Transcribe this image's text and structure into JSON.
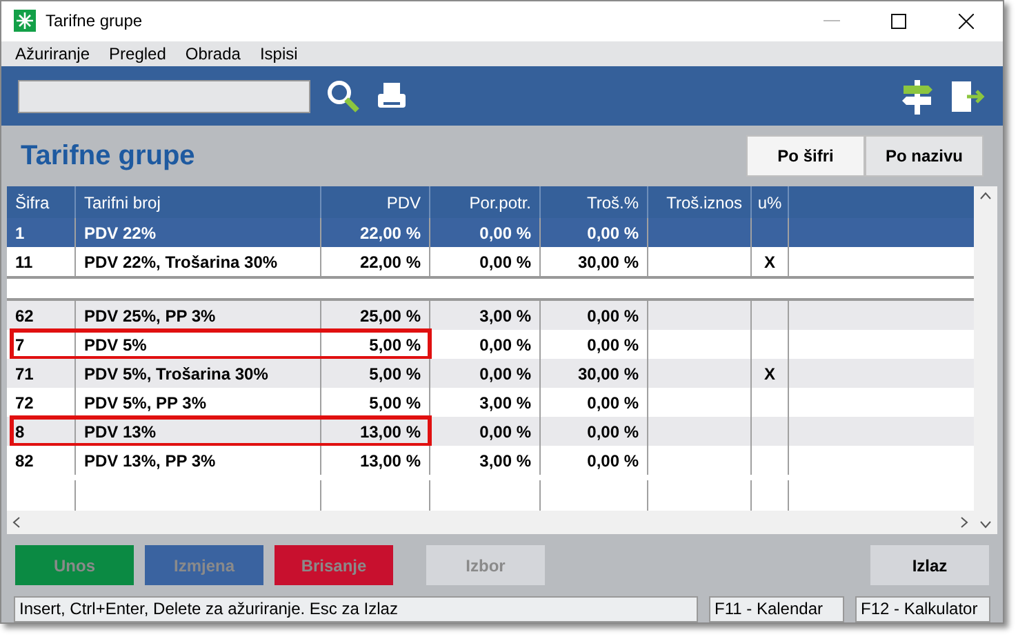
{
  "window": {
    "title": "Tarifne grupe"
  },
  "menu": [
    "Ažuriranje",
    "Pregled",
    "Obrada",
    "Ispisi"
  ],
  "heading": "Tarifne grupe",
  "sort_tabs": [
    {
      "label": "Po šifri",
      "selected": true
    },
    {
      "label": "Po nazivu",
      "selected": false
    }
  ],
  "table": {
    "columns": [
      "Šifra",
      "Tarifni broj",
      "PDV",
      "Por.potr.",
      "Troš.%",
      "Troš.iznos",
      "u%"
    ],
    "segments": [
      {
        "rows": [
          {
            "cells": [
              "1",
              "PDV 22%",
              "22,00 %",
              "0,00 %",
              "0,00 %",
              "",
              ""
            ],
            "selected": true,
            "marked": false
          },
          {
            "cells": [
              "11",
              "PDV 22%, Trošarina 30%",
              "22,00 %",
              "0,00 %",
              "30,00 %",
              "",
              "X"
            ],
            "selected": false,
            "marked": false
          }
        ]
      },
      {
        "rows": [
          {
            "cells": [
              "62",
              "PDV 25%, PP 3%",
              "25,00 %",
              "3,00 %",
              "0,00 %",
              "",
              ""
            ],
            "selected": false,
            "marked": false
          },
          {
            "cells": [
              "7",
              "PDV 5%",
              "5,00 %",
              "0,00 %",
              "0,00 %",
              "",
              ""
            ],
            "selected": false,
            "marked": true
          },
          {
            "cells": [
              "71",
              "PDV 5%, Trošarina 30%",
              "5,00 %",
              "0,00 %",
              "30,00 %",
              "",
              "X"
            ],
            "selected": false,
            "marked": false
          },
          {
            "cells": [
              "72",
              "PDV 5%, PP 3%",
              "5,00 %",
              "3,00 %",
              "0,00 %",
              "",
              ""
            ],
            "selected": false,
            "marked": false
          },
          {
            "cells": [
              "8",
              "PDV 13%",
              "13,00 %",
              "0,00 %",
              "0,00 %",
              "",
              ""
            ],
            "selected": false,
            "marked": true
          },
          {
            "cells": [
              "82",
              "PDV 13%, PP 3%",
              "13,00 %",
              "3,00 %",
              "0,00 %",
              "",
              ""
            ],
            "selected": false,
            "marked": false
          }
        ]
      }
    ]
  },
  "buttons": [
    {
      "label": "Unos",
      "kind": "green",
      "disabled": true
    },
    {
      "label": "Izmjena",
      "kind": "blue",
      "disabled": true
    },
    {
      "label": "Brisanje",
      "kind": "red",
      "disabled": true
    },
    {
      "label": "Izbor",
      "kind": "gray",
      "disabled": true
    },
    {
      "label": "Izlaz",
      "kind": "gray",
      "disabled": false
    }
  ],
  "status_bar": [
    "Insert, Ctrl+Enter, Delete za ažuriranje. Esc za Izlaz",
    "F11 - Kalendar",
    "F12 - Kalkulator"
  ]
}
